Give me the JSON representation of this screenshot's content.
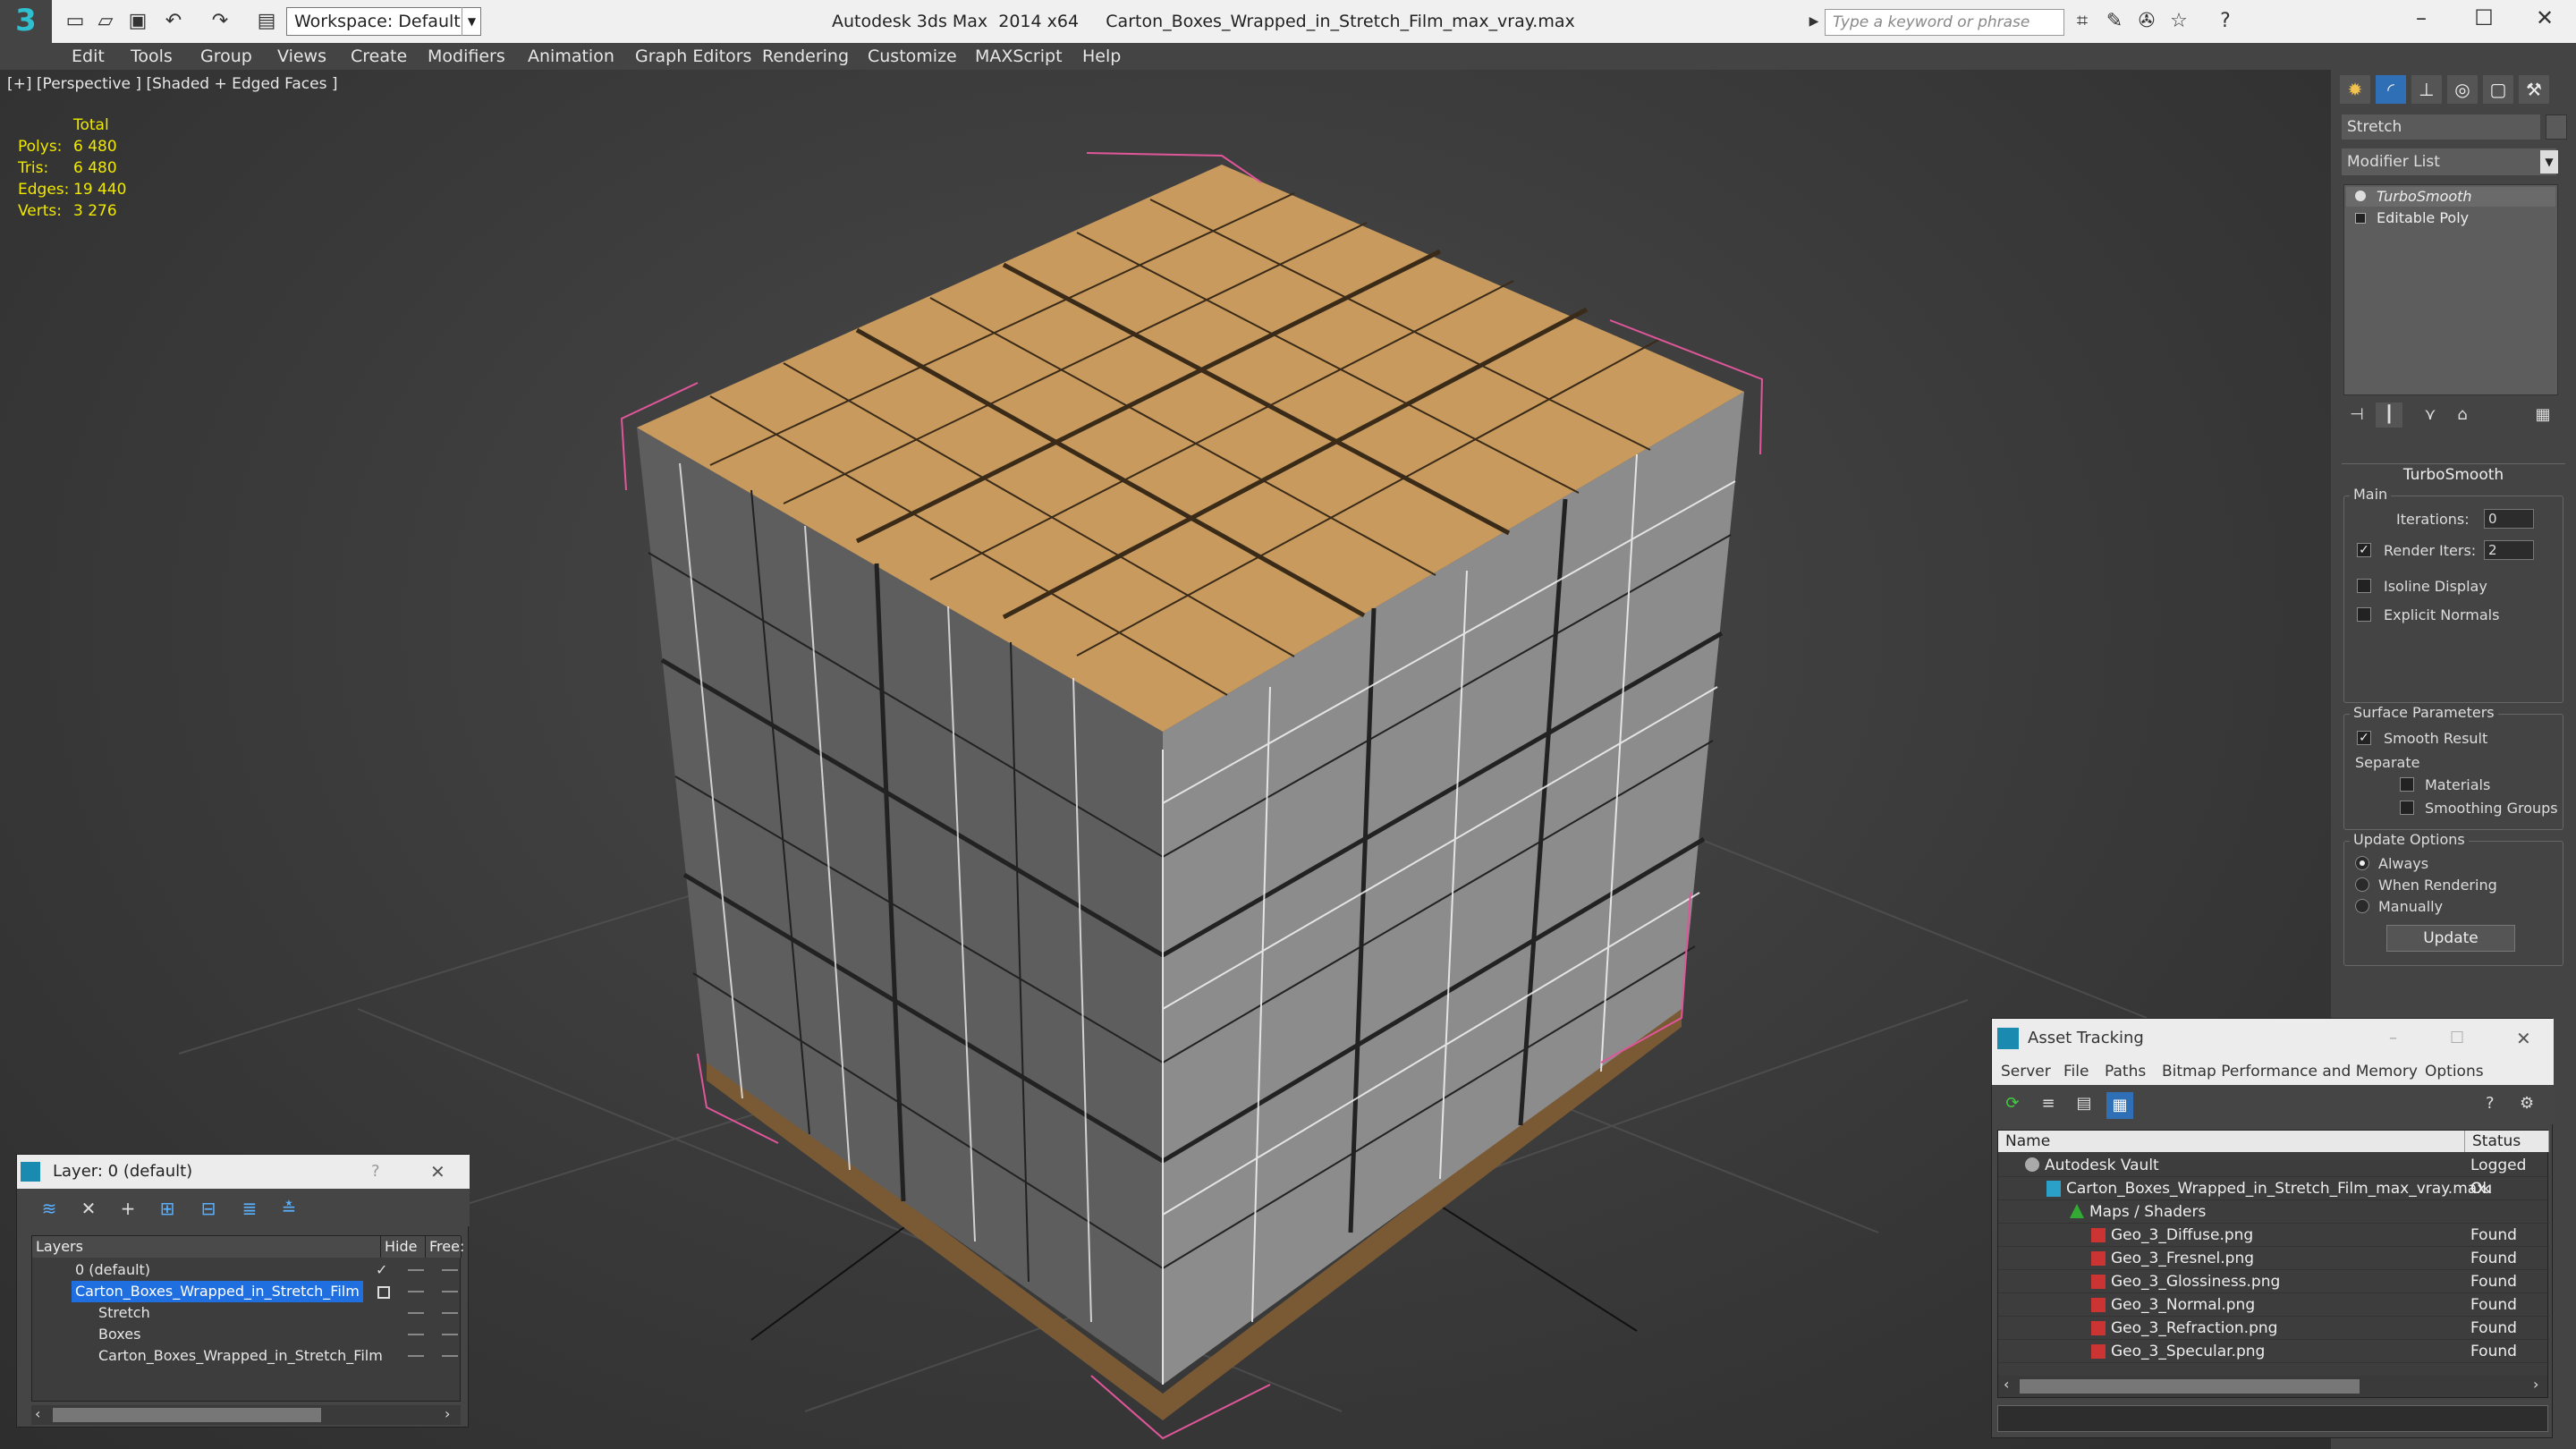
{
  "titlebar": {
    "workspace": "Workspace: Default",
    "app_title": "Autodesk 3ds Max  2014 x64",
    "file_title": "Carton_Boxes_Wrapped_in_Stretch_Film_max_vray.max",
    "search_placeholder": "Type a keyword or phrase"
  },
  "menu": [
    "Edit",
    "Tools",
    "Group",
    "Views",
    "Create",
    "Modifiers",
    "Animation",
    "Graph Editors",
    "Rendering",
    "Customize",
    "MAXScript",
    "Help"
  ],
  "viewport": {
    "label": "[+] [Perspective ] [Shaded + Edged Faces ]",
    "stats": {
      "header": "Total",
      "rows": [
        {
          "k": "Polys:",
          "v": "6 480"
        },
        {
          "k": "Tris:",
          "v": "6 480"
        },
        {
          "k": "Edges:",
          "v": "19 440"
        },
        {
          "k": "Verts:",
          "v": "3 276"
        }
      ]
    }
  },
  "command_panel": {
    "object_name": "Stretch",
    "modifier_list": "Modifier List",
    "stack": [
      "TurboSmooth",
      "Editable Poly"
    ],
    "rollout_title": "TurboSmooth",
    "main_group": "Main",
    "iterations_label": "Iterations:",
    "iterations_value": "0",
    "render_iters_label": "Render Iters:",
    "render_iters_value": "2",
    "isoline": "Isoline Display",
    "explicit_normals": "Explicit Normals",
    "surface_group": "Surface Parameters",
    "smooth_result": "Smooth Result",
    "separate": "Separate",
    "materials": "Materials",
    "smoothing_groups": "Smoothing Groups",
    "update_group": "Update Options",
    "always": "Always",
    "when_rendering": "When Rendering",
    "manually": "Manually",
    "update_button": "Update"
  },
  "layer_panel": {
    "title": "Layer: 0 (default)",
    "help": "?",
    "col_layers": "Layers",
    "col_hide": "Hide",
    "col_freeze": "Free:",
    "rows": [
      {
        "name": "0 (default)"
      },
      {
        "name": "Carton_Boxes_Wrapped_in_Stretch_Film"
      },
      {
        "name": "Stretch"
      },
      {
        "name": "Boxes"
      },
      {
        "name": "Carton_Boxes_Wrapped_in_Stretch_Film"
      }
    ]
  },
  "asset_panel": {
    "title": "Asset Tracking",
    "menu": [
      "Server",
      "File",
      "Paths",
      "Bitmap Performance and Memory",
      "Options"
    ],
    "col_name": "Name",
    "col_status": "Status",
    "rows": [
      {
        "name": "Autodesk Vault",
        "status": "Logged Ou"
      },
      {
        "name": "Carton_Boxes_Wrapped_in_Stretch_Film_max_vray.max",
        "status": "Ok"
      },
      {
        "name": "Maps / Shaders",
        "status": ""
      },
      {
        "name": "Geo_3_Diffuse.png",
        "status": "Found"
      },
      {
        "name": "Geo_3_Fresnel.png",
        "status": "Found"
      },
      {
        "name": "Geo_3_Glossiness.png",
        "status": "Found"
      },
      {
        "name": "Geo_3_Normal.png",
        "status": "Found"
      },
      {
        "name": "Geo_3_Refraction.png",
        "status": "Found"
      },
      {
        "name": "Geo_3_Specular.png",
        "status": "Found"
      }
    ]
  }
}
